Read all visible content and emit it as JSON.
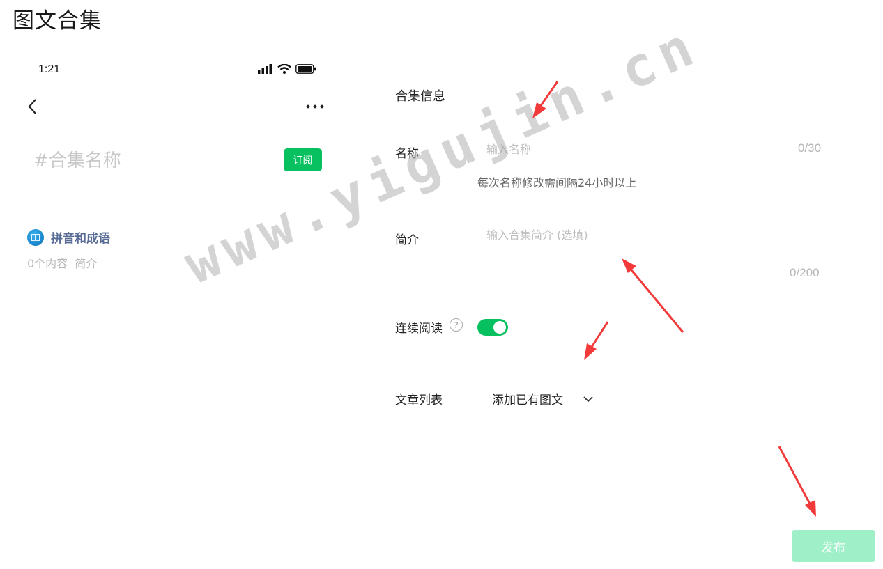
{
  "page": {
    "title": "图文合集"
  },
  "preview": {
    "time": "1:21",
    "collection_name": "#合集名称",
    "subscribe_label": "订阅",
    "account_name": "拼音和成语",
    "content_count": "0个内容",
    "intro_link": "简介"
  },
  "form": {
    "section_title": "合集信息",
    "name_label": "名称",
    "name_placeholder": "输入名称",
    "name_counter": "0/30",
    "name_hint": "每次名称修改需间隔24小时以上",
    "intro_label": "简介",
    "intro_placeholder": "输入合集简介 (选填)",
    "intro_counter": "0/200",
    "continuous_label": "连续阅读",
    "continuous_enabled": true,
    "article_list_label": "文章列表",
    "article_dropdown_value": "添加已有图文",
    "publish_label": "发布"
  },
  "watermark": "www.yigujin.cn",
  "colors": {
    "accent": "#07c160",
    "publish_disabled": "#9ff0c8",
    "link": "#576b95",
    "arrow": "#f23a3a"
  }
}
